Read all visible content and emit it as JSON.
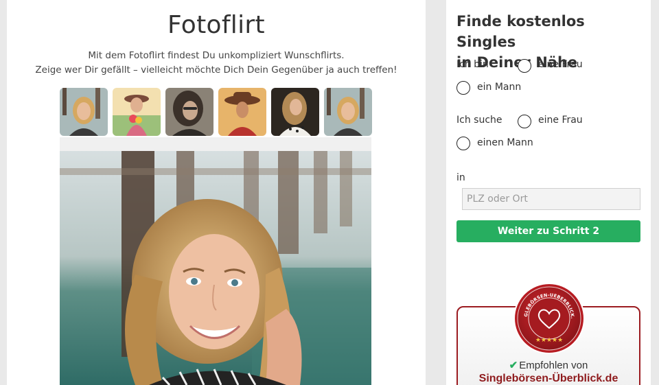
{
  "main": {
    "title": "Fotoflirt",
    "intro_line1": "Mit dem Fotoflirt findest Du unkompliziert Wunschflirts.",
    "intro_line2": "Zeige wer Dir gefällt – vielleicht möchte Dich Dein Gegenüber ja auch treffen!",
    "thumbnails": [
      "profile-photo-1",
      "profile-photo-2",
      "profile-photo-3",
      "profile-photo-4",
      "profile-photo-5",
      "profile-photo-6"
    ]
  },
  "sidebar": {
    "title_line1": "Finde kostenlos Singles",
    "title_line2": "in Deiner Nähe",
    "i_am": {
      "label": "Ich bin",
      "options": [
        "eine Frau",
        "ein Mann"
      ]
    },
    "i_seek": {
      "label": "Ich suche",
      "options": [
        "eine Frau",
        "einen Mann"
      ]
    },
    "location": {
      "label": "in",
      "placeholder": "PLZ oder Ort",
      "value": ""
    },
    "submit_label": "Weiter zu Schritt 2",
    "badge": {
      "seal_text": "SINGLEBÖRSEN-UEBERBLICK.DE",
      "stars": "★★★★★",
      "recommended": "Empfohlen von",
      "site": "Singlebörsen-Überblick.de"
    }
  },
  "colors": {
    "accent_green": "#27ae60",
    "badge_red": "#9b1b20"
  }
}
